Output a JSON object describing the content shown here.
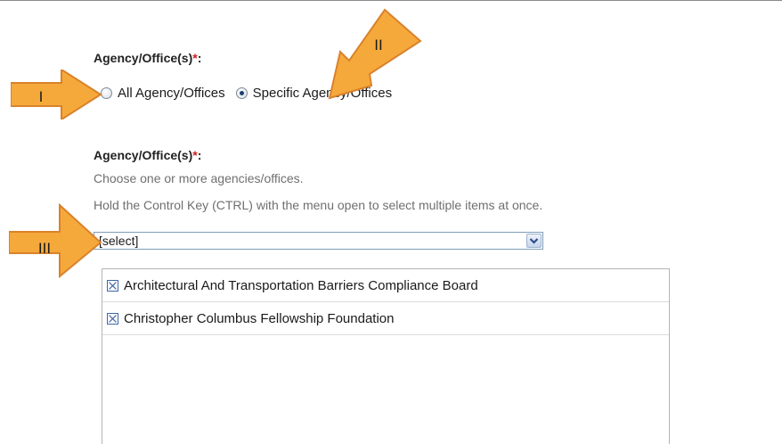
{
  "agency_filter": {
    "label": "Agency/Office(s)",
    "required_mark": "*",
    "colon": ":",
    "options": [
      {
        "label": "All Agency/Offices",
        "checked": false
      },
      {
        "label": "Specific Agency/Offices",
        "checked": true
      }
    ]
  },
  "agency_select": {
    "label": "Agency/Office(s)",
    "required_mark": "*",
    "colon": ":",
    "help_line_1": "Choose one or more agencies/offices.",
    "help_line_2": "Hold the Control Key (CTRL) with the menu open to select multiple items at once.",
    "dropdown_value": "[select]",
    "selected_items": [
      {
        "label": "Architectural And Transportation Barriers Compliance Board",
        "icon": "remove-x-icon"
      },
      {
        "label": "Christopher Columbus Fellowship Foundation",
        "icon": "remove-x-icon"
      }
    ]
  },
  "callouts": {
    "one": "I",
    "two": "II",
    "three": "III",
    "fill_color": "#f6a93b",
    "edge_color": "#d9822b"
  },
  "colors": {
    "required": "#d11a1a",
    "help_text": "#6f6f6f",
    "select_border": "#7f9db9",
    "checkbox_border": "#3f67a8"
  }
}
